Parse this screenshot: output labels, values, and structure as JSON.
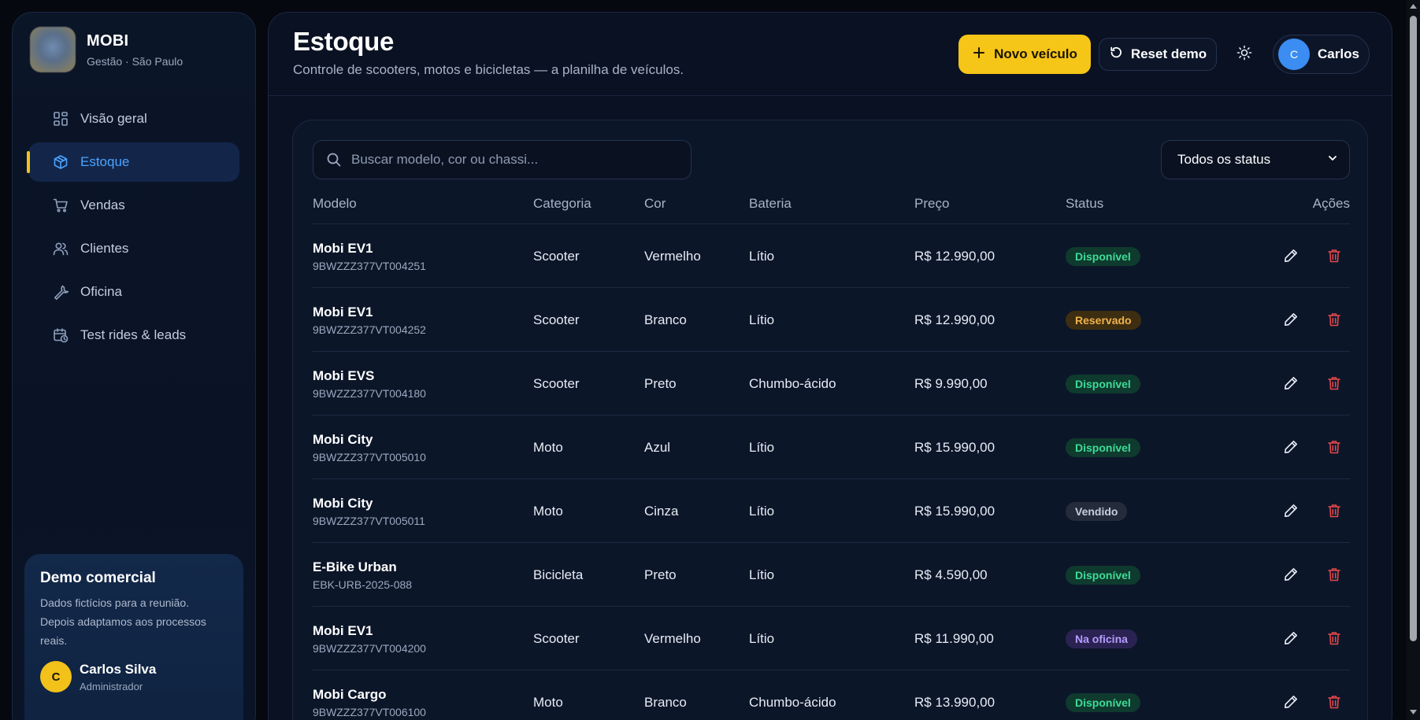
{
  "brand": {
    "name": "MOBI",
    "subtitle": "Gestão · São Paulo"
  },
  "nav": [
    {
      "label": "Visão geral",
      "icon": "grid-icon",
      "active": false
    },
    {
      "label": "Estoque",
      "icon": "package-icon",
      "active": true
    },
    {
      "label": "Vendas",
      "icon": "cart-icon",
      "active": false
    },
    {
      "label": "Clientes",
      "icon": "users-icon",
      "active": false
    },
    {
      "label": "Oficina",
      "icon": "wrench-icon",
      "active": false
    },
    {
      "label": "Test rides & leads",
      "icon": "calendar-clock-icon",
      "active": false
    }
  ],
  "demo": {
    "title": "Demo comercial",
    "text": "Dados fictícios para a reunião. Depois adaptamos aos processos reais.",
    "user_initial": "C",
    "user_name": "Carlos Silva",
    "user_role": "Administrador"
  },
  "header": {
    "title": "Estoque",
    "subtitle": "Controle de scooters, motos e bicicletas — a planilha de veículos.",
    "new_button": "Novo veículo",
    "reset_button": "Reset demo",
    "user_initial": "C",
    "user_name": "Carlos"
  },
  "filters": {
    "search_placeholder": "Buscar modelo, cor ou chassi...",
    "status_selected": "Todos os status"
  },
  "table": {
    "columns": [
      "Modelo",
      "Categoria",
      "Cor",
      "Bateria",
      "Preço",
      "Status",
      "Ações"
    ],
    "rows": [
      {
        "model": "Mobi EV1",
        "vin": "9BWZZZ377VT004251",
        "category": "Scooter",
        "color": "Vermelho",
        "battery": "Lítio",
        "price": "R$ 12.990,00",
        "status": "Disponível",
        "status_kind": "available"
      },
      {
        "model": "Mobi EV1",
        "vin": "9BWZZZ377VT004252",
        "category": "Scooter",
        "color": "Branco",
        "battery": "Lítio",
        "price": "R$ 12.990,00",
        "status": "Reservado",
        "status_kind": "reserved"
      },
      {
        "model": "Mobi EVS",
        "vin": "9BWZZZ377VT004180",
        "category": "Scooter",
        "color": "Preto",
        "battery": "Chumbo-ácido",
        "price": "R$ 9.990,00",
        "status": "Disponível",
        "status_kind": "available"
      },
      {
        "model": "Mobi City",
        "vin": "9BWZZZ377VT005010",
        "category": "Moto",
        "color": "Azul",
        "battery": "Lítio",
        "price": "R$ 15.990,00",
        "status": "Disponível",
        "status_kind": "available"
      },
      {
        "model": "Mobi City",
        "vin": "9BWZZZ377VT005011",
        "category": "Moto",
        "color": "Cinza",
        "battery": "Lítio",
        "price": "R$ 15.990,00",
        "status": "Vendido",
        "status_kind": "sold"
      },
      {
        "model": "E-Bike Urban",
        "vin": "EBK-URB-2025-088",
        "category": "Bicicleta",
        "color": "Preto",
        "battery": "Lítio",
        "price": "R$ 4.590,00",
        "status": "Disponível",
        "status_kind": "available"
      },
      {
        "model": "Mobi EV1",
        "vin": "9BWZZZ377VT004200",
        "category": "Scooter",
        "color": "Vermelho",
        "battery": "Lítio",
        "price": "R$ 11.990,00",
        "status": "Na oficina",
        "status_kind": "workshop"
      },
      {
        "model": "Mobi Cargo",
        "vin": "9BWZZZ377VT006100",
        "category": "Moto",
        "color": "Branco",
        "battery": "Chumbo-ácido",
        "price": "R$ 13.990,00",
        "status": "Disponível",
        "status_kind": "available"
      }
    ]
  },
  "colors": {
    "accent": "#f5c518",
    "active_blue": "#4aa3ff",
    "delete_red": "#e5484d",
    "available": "#3ddc97",
    "reserved": "#f0b24a",
    "sold": "#c7cfdd",
    "workshop": "#b69cff"
  }
}
